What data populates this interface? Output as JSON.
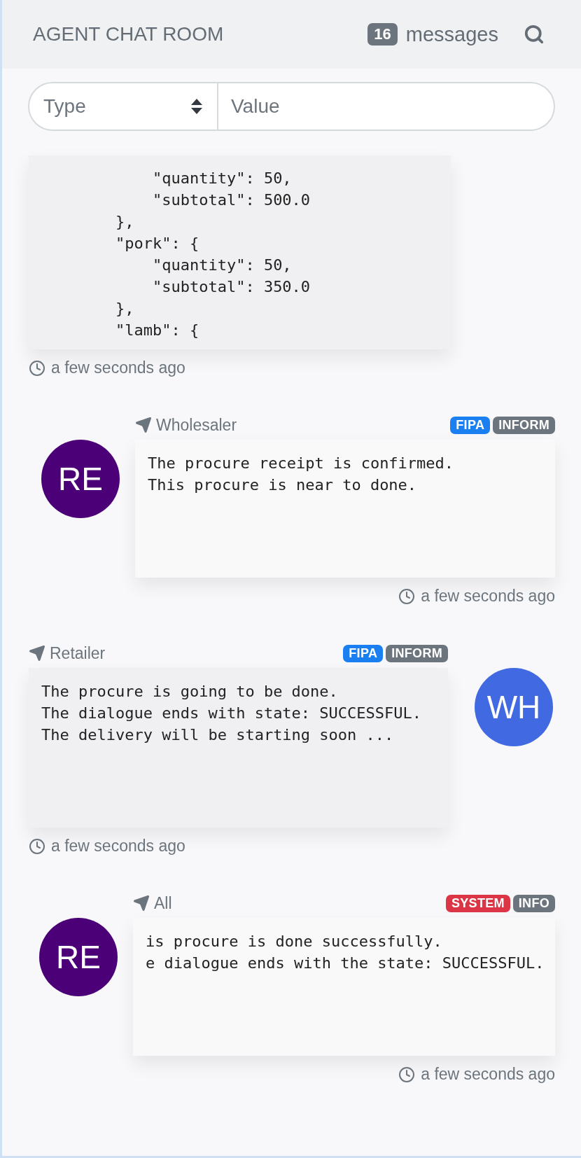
{
  "header": {
    "title": "AGENT CHAT ROOM",
    "count": "16",
    "count_label": "messages"
  },
  "filter": {
    "type_placeholder": "Type",
    "value_placeholder": "Value"
  },
  "messages": [
    {
      "kind": "code",
      "lines": [
        "            \"quantity\": 50,",
        "            \"subtotal\": 500.0",
        "        },",
        "        \"pork\": {",
        "            \"quantity\": 50,",
        "            \"subtotal\": 350.0",
        "        },",
        "        \"lamb\": {"
      ],
      "time": "a few seconds ago"
    },
    {
      "avatar_left": true,
      "kind": "text",
      "sender": "Wholesaler",
      "tags": [
        {
          "label": "FIPA",
          "color": "#1a7ff0"
        },
        {
          "label": "INFORM",
          "color": "#6c757d"
        }
      ],
      "avatar": {
        "initials": "RE",
        "color": "#4b0078"
      },
      "lines": [
        "The procure receipt is confirmed.",
        "This procure is near to done."
      ],
      "time": "a few seconds ago"
    },
    {
      "avatar_left": false,
      "kind": "text",
      "sender": "Retailer",
      "tags": [
        {
          "label": "FIPA",
          "color": "#1a7ff0"
        },
        {
          "label": "INFORM",
          "color": "#6c757d"
        }
      ],
      "avatar": {
        "initials": "WH",
        "color": "#4169e1"
      },
      "lines": [
        "The procure is going to be done.",
        "The dialogue ends with state: SUCCESSFUL.",
        "The delivery will be starting soon ..."
      ],
      "time": "a few seconds ago"
    },
    {
      "avatar_left": true,
      "kind": "text",
      "sender": "All",
      "tags": [
        {
          "label": "SYSTEM",
          "color": "#dc3545"
        },
        {
          "label": "INFO",
          "color": "#6c757d"
        }
      ],
      "avatar": {
        "initials": "RE",
        "color": "#4b0078"
      },
      "lines": [
        "is procure is done successfully.",
        "e dialogue ends with the state: SUCCESSFUL."
      ],
      "time": "a few seconds ago"
    }
  ]
}
